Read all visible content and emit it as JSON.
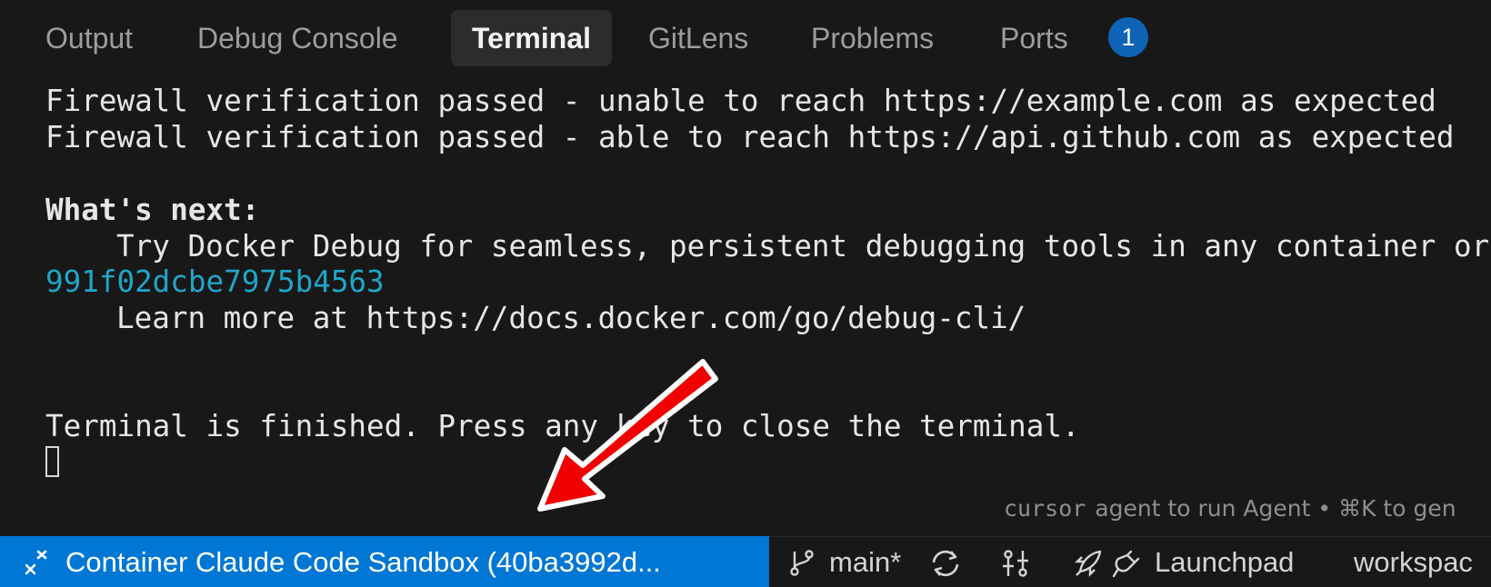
{
  "tabs": [
    {
      "label": "Output"
    },
    {
      "label": "Debug Console"
    },
    {
      "label": "Terminal",
      "active": true
    },
    {
      "label": "GitLens"
    },
    {
      "label": "Problems"
    },
    {
      "label": "Ports",
      "badge": "1"
    }
  ],
  "terminal": {
    "lines": [
      "Firewall verification passed - unable to reach https://example.com as expected",
      "Firewall verification passed - able to reach https://api.github.com as expected",
      "What's next:",
      "Try Docker Debug for seamless, persistent debugging tools in any container or",
      "991f02dcbe7975b4563",
      "Learn more at https://docs.docker.com/go/debug-cli/",
      "Terminal is finished. Press any key to close the terminal."
    ]
  },
  "hint": {
    "command": "cursor",
    "text": "agent to run Agent • ⌘K to gen"
  },
  "statusbar": {
    "remote_label": "Container Claude Code Sandbox (40ba3992d...",
    "branch": "main*",
    "launchpad": "Launchpad",
    "workspace": "workspac"
  },
  "colors": {
    "background": "#181818",
    "remote_accent": "#0077d4",
    "badge": "#0e63b6",
    "link": "#1fa6c9",
    "arrow": "#f20000"
  },
  "icons": {
    "remote": "remote-connection-icon",
    "branch": "git-branch-icon",
    "sync": "sync-icon",
    "compare": "git-compare-icon",
    "launchpad": "rocket-icon",
    "plug": "plug-icon",
    "annotation": "red-arrow-annotation"
  }
}
